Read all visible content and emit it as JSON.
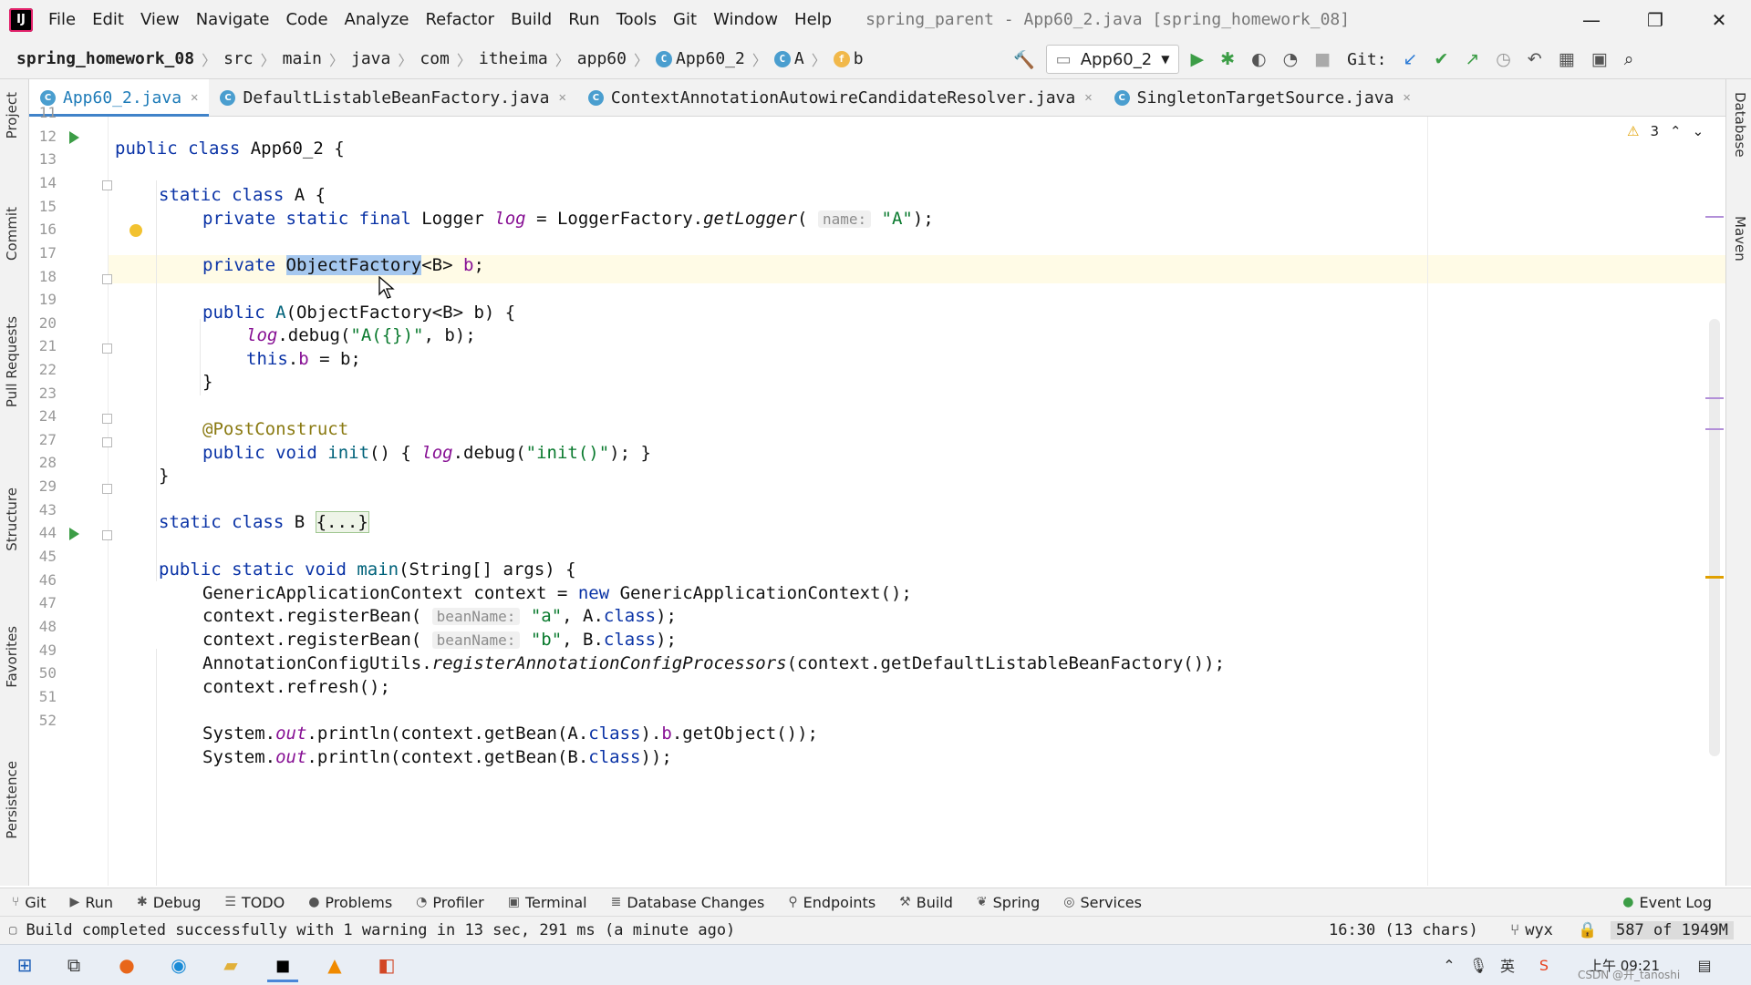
{
  "app": {
    "menu": [
      "File",
      "Edit",
      "View",
      "Navigate",
      "Code",
      "Analyze",
      "Refactor",
      "Build",
      "Run",
      "Tools",
      "Git",
      "Window",
      "Help"
    ],
    "window_title": "spring_parent - App60_2.java [spring_homework_08]",
    "logo_text": "IJ"
  },
  "breadcrumbs": [
    "spring_homework_08",
    "src",
    "main",
    "java",
    "com",
    "itheima",
    "app60",
    "App60_2",
    "A",
    "b"
  ],
  "toolbar": {
    "run_config": "App60_2",
    "git_label": "Git:"
  },
  "tabs": [
    {
      "label": "App60_2.java",
      "active": true
    },
    {
      "label": "DefaultListableBeanFactory.java",
      "active": false
    },
    {
      "label": "ContextAnnotationAutowireCandidateResolver.java",
      "active": false
    },
    {
      "label": "SingletonTargetSource.java",
      "active": false
    }
  ],
  "left_tool_tabs": [
    "Project",
    "Commit",
    "Pull Requests",
    "Structure",
    "Favorites",
    "Persistence"
  ],
  "right_tool_tabs": [
    "Database",
    "Maven"
  ],
  "inspections": {
    "warnings": "3"
  },
  "gutter_lines": [
    "11",
    "12",
    "13",
    "14",
    "15",
    "16",
    "17",
    "18",
    "19",
    "20",
    "21",
    "22",
    "23",
    "24",
    "27",
    "28",
    "29",
    "43",
    "44",
    "45",
    "46",
    "47",
    "48",
    "49",
    "50",
    "51",
    "52"
  ],
  "code": {
    "l12": [
      "public class ",
      "App60_2 {"
    ],
    "l14": [
      "static class ",
      "A {"
    ],
    "l15": [
      "private static final ",
      "Logger ",
      "log",
      " = LoggerFactory.",
      "getLogger",
      "( ",
      "name:",
      " \"A\"",
      ");"
    ],
    "l16": [
      "private ",
      "ObjectFactory",
      "<B> ",
      "b",
      ";"
    ],
    "l18": [
      "public ",
      "A",
      "(",
      "ObjectFactory",
      "<B> b) {"
    ],
    "l19": [
      "log",
      ".debug(",
      "\"A({})\"",
      ", b);"
    ],
    "l20": [
      "this",
      ".",
      "b",
      " = b;"
    ],
    "l21": [
      "}"
    ],
    "l23": [
      "@PostConstruct"
    ],
    "l24": [
      "public void ",
      "init",
      "() { ",
      "log",
      ".debug(",
      "\"init()\"",
      "); }"
    ],
    "l27": [
      "}"
    ],
    "l29": [
      "static class ",
      "B ",
      "{...}"
    ],
    "l44": [
      "public static void ",
      "main",
      "(String[] args) {"
    ],
    "l45": [
      "GenericApplicationContext context = ",
      "new ",
      "GenericApplicationContext();"
    ],
    "l46": [
      "context.registerBean( ",
      "beanName:",
      " \"a\"",
      ", A.",
      "class",
      ");"
    ],
    "l47": [
      "context.registerBean( ",
      "beanName:",
      " \"b\"",
      ", B.",
      "class",
      ");"
    ],
    "l48": [
      "AnnotationConfigUtils.",
      "registerAnnotationConfigProcessors",
      "(context.getDefaultListableBeanFactory());"
    ],
    "l49": [
      "context.refresh();"
    ],
    "l51": [
      "System.",
      "out",
      ".println(context.getBean(A.",
      "class",
      ").",
      "b",
      ".getObject());"
    ],
    "l52": [
      "System.",
      "out",
      ".println(context.getBean(B.",
      "class",
      "));"
    ]
  },
  "tool_windows": [
    "Git",
    "Run",
    "Debug",
    "TODO",
    "Problems",
    "Profiler",
    "Terminal",
    "Database Changes",
    "Endpoints",
    "Build",
    "Spring",
    "Services"
  ],
  "event_log": "Event Log",
  "status": {
    "message": "Build completed successfully with 1 warning in 13 sec, 291 ms (a minute ago)",
    "caret": "16:30 (13 chars)",
    "branch": "wyx",
    "memory": "587 of 1949M"
  },
  "taskbar": {
    "time": "上午 09:21",
    "ime": "英",
    "watermark": "CSDN @开_tanoshi"
  }
}
